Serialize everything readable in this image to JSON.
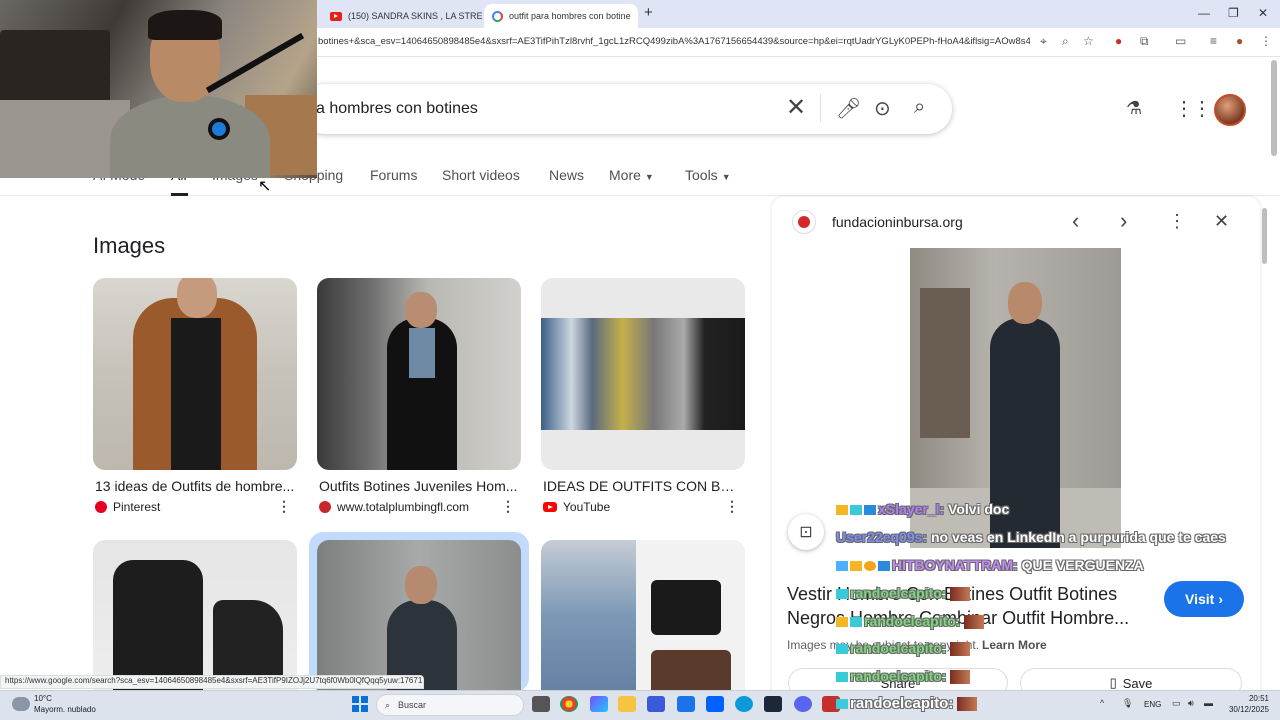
{
  "browser": {
    "tabs": [
      {
        "title": "(150) SANDRA SKINS , LA STRE",
        "favicon": "youtube-icon",
        "active": false
      },
      {
        "title": "outfit para hombres con botine",
        "favicon": "google-icon",
        "active": true
      }
    ],
    "new_tab_symbol": "+",
    "address_url": "botines+&sca_esv=14064650898485e4&sxsrf=AE3TifPihTzl8rvhf_1gcL1zRCQ499zibA%3A1767156654439&source=hp&ei=rqtUadrYGLyK0PEPh-fHoA4&iflsig=AOw8s4IAAA...",
    "window_controls": [
      "—",
      "❐",
      "✕"
    ]
  },
  "search": {
    "query": "a hombres con botines",
    "clear_symbol": "✕"
  },
  "filters": {
    "items": [
      {
        "label": "AI Mode"
      },
      {
        "label": "All",
        "active": true
      },
      {
        "label": "Images"
      },
      {
        "label": "Shopping"
      },
      {
        "label": "Forums"
      },
      {
        "label": "Short videos"
      },
      {
        "label": "News"
      },
      {
        "label": "More",
        "dropdown": true
      },
      {
        "label": "Tools",
        "dropdown": true
      }
    ]
  },
  "images_section": {
    "heading": "Images",
    "cards": [
      {
        "title": "13 ideas de Outfits de hombre...",
        "source": "Pinterest",
        "source_icon": "pinterest-icon"
      },
      {
        "title": "Outfits Botines Juveniles Hom...",
        "source": "www.totalplumbingfl.com",
        "source_icon": "site-icon"
      },
      {
        "title": "IDEAS DE OUTFITS CON BOT...",
        "source": "YouTube",
        "source_icon": "youtube-icon"
      }
    ]
  },
  "side_panel": {
    "domain": "fundacioninbursa.org",
    "title": "Vestir Hombre Con Botines Outfit Botines Negros Hombre Combinar Outfit Hombre...",
    "visit_label": "Visit",
    "notice": "Images may be subject to copyright.",
    "learn_more": "Learn More",
    "share_label": "Share",
    "save_label": "Save"
  },
  "chat": [
    {
      "user": "xSlayer_l:",
      "message": " Volvi doc",
      "badges": [
        "crown",
        "grid",
        "cube"
      ]
    },
    {
      "user": "User22eq09s:",
      "message": " no veas en LinkedIn a purpurida que te caes",
      "badges": []
    },
    {
      "user": "HITBOYNATTRAM:",
      "message": " QUE VERGUENZA",
      "badges": [
        "sword",
        "crown",
        "coin",
        "cube"
      ]
    },
    {
      "user": "randoelcapito:",
      "message": "",
      "badges": [
        "grid"
      ]
    },
    {
      "user": "randoelcapito:",
      "message": "",
      "badges": [
        "crown",
        "grid"
      ]
    },
    {
      "user": "randoelcapito:",
      "message": "",
      "badges": [
        "grid"
      ]
    },
    {
      "user": "randoelcapito:",
      "message": "",
      "badges": [
        "grid"
      ]
    },
    {
      "user": "randoelcapito:",
      "message": "",
      "badges": [
        "grid"
      ]
    }
  ],
  "status_bar_url": "https://www.google.com/search?sca_esv=14064650898485e4&sxsrf=AE3TifP9IZOJj2U7tq6f0Wb0lQfQqq5yuw:17671...",
  "taskbar": {
    "weather_temp": "10°C",
    "weather_desc": "Mayorm. nublado",
    "search_placeholder": "Buscar",
    "language": "ENG",
    "time": "20:51",
    "date": "30/12/2025"
  }
}
